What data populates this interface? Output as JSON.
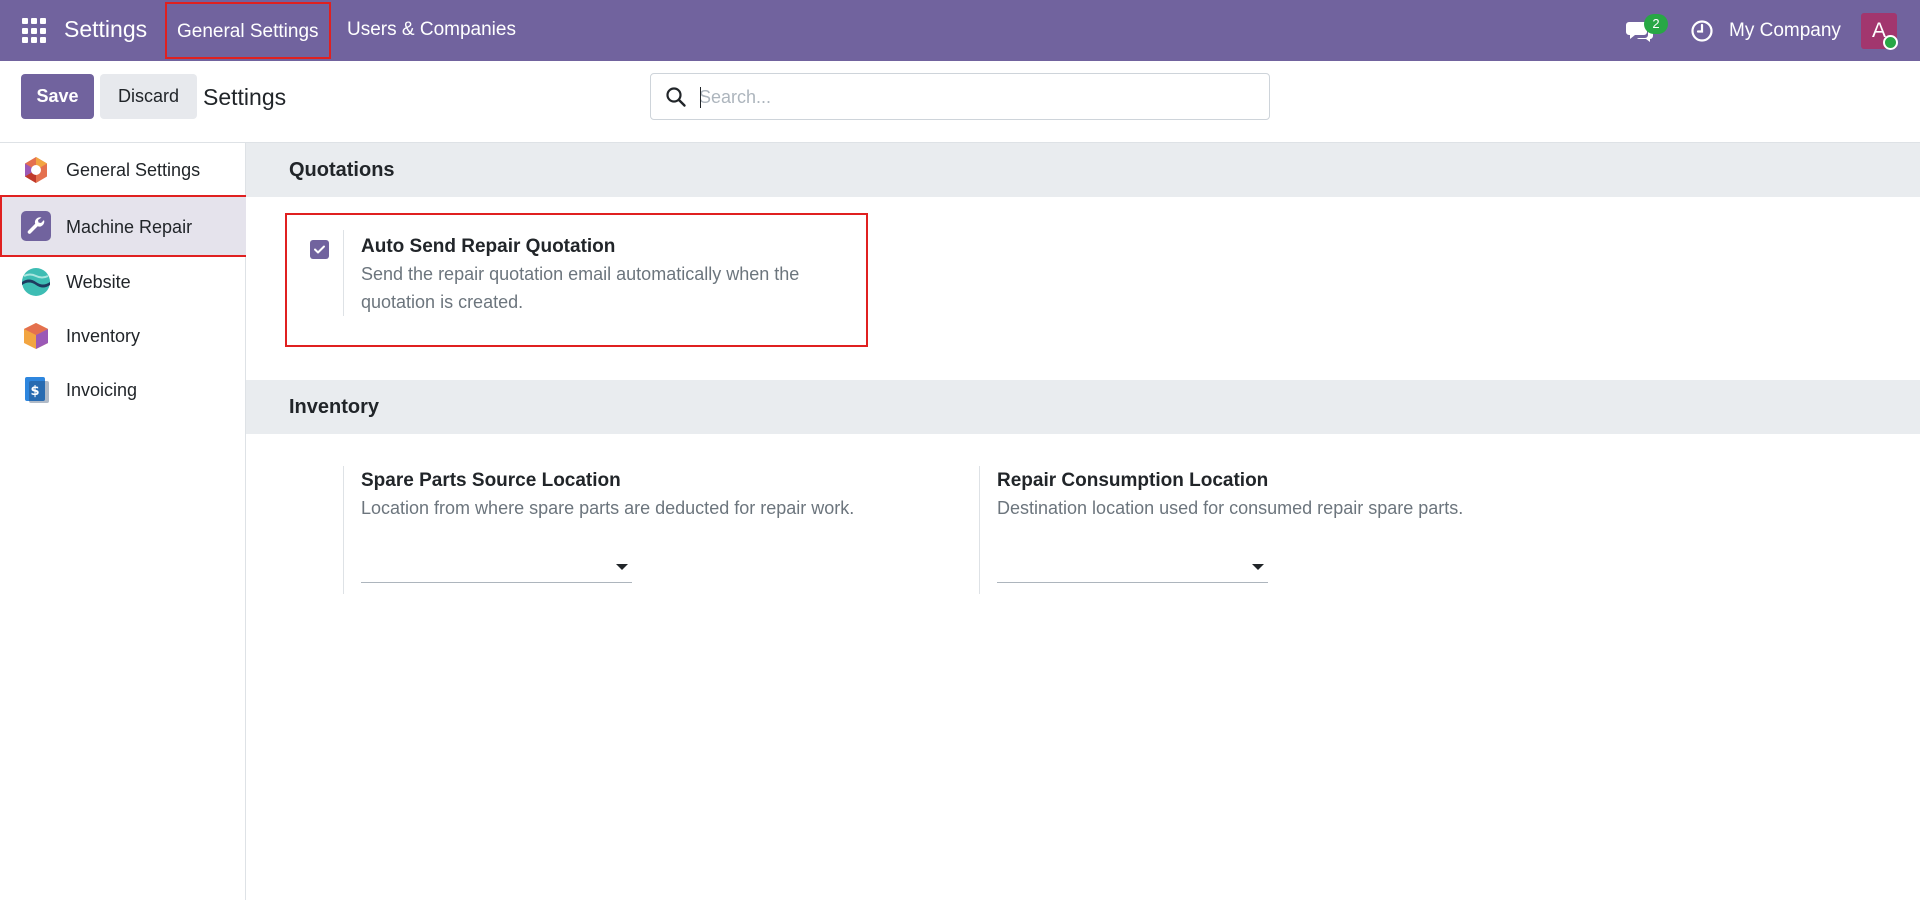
{
  "navbar": {
    "app_title": "Settings",
    "menu": [
      "General Settings",
      "Users & Companies"
    ],
    "chat_count": "2",
    "company": "My Company",
    "avatar_initial": "A"
  },
  "control_panel": {
    "save_label": "Save",
    "discard_label": "Discard",
    "title": "Settings",
    "search_placeholder": "Search..."
  },
  "sidebar": {
    "items": [
      {
        "label": "General Settings",
        "icon": "settings-hexagon-icon"
      },
      {
        "label": "Machine Repair",
        "icon": "wrench-icon",
        "active": true
      },
      {
        "label": "Website",
        "icon": "website-icon"
      },
      {
        "label": "Inventory",
        "icon": "inventory-box-icon"
      },
      {
        "label": "Invoicing",
        "icon": "invoicing-icon"
      }
    ]
  },
  "sections": {
    "quotations": {
      "title": "Quotations",
      "auto_send": {
        "title": "Auto Send Repair Quotation",
        "desc_line1": "Send the repair quotation email automatically when the",
        "desc_line2": "quotation is created.",
        "checked": true
      }
    },
    "inventory": {
      "title": "Inventory",
      "spare_parts": {
        "title": "Spare Parts Source Location",
        "desc": "Location from where spare parts are deducted for repair work.",
        "value": ""
      },
      "consumption": {
        "title": "Repair Consumption Location",
        "desc": "Destination location used for consumed repair spare parts.",
        "value": ""
      }
    }
  },
  "colors": {
    "brand": "#71639e",
    "highlight": "#e02020",
    "badge": "#28a745"
  }
}
